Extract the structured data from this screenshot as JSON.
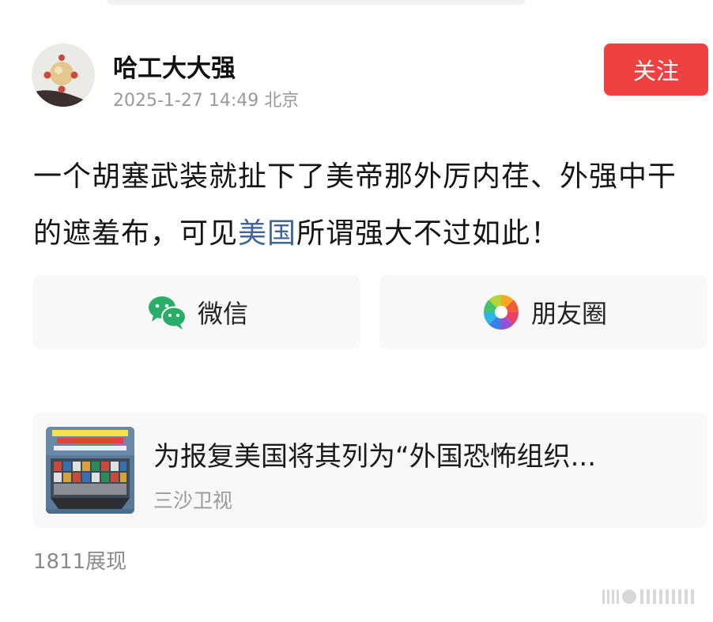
{
  "author": {
    "name": "哈工大大强",
    "meta": "2025-1-27 14:49 北京"
  },
  "follow_label": "关注",
  "post": {
    "text_before": "一个胡塞武装就扯下了美帝那外厉内荏、外强中干的遮羞布，可见",
    "link_text": "美国",
    "text_after": "所谓强大不过如此！"
  },
  "share": {
    "wechat_label": "微信",
    "moments_label": "朋友圈"
  },
  "article": {
    "title": "为报复美国将其列为“外国恐怖组织...",
    "source": "三沙卫视"
  },
  "views_label": "1811展现",
  "colors": {
    "follow_button": "#f04142",
    "link": "#406599",
    "wechat_green": "#2aae67"
  },
  "icons": {
    "wechat": "wechat-icon",
    "moments": "moments-icon"
  }
}
